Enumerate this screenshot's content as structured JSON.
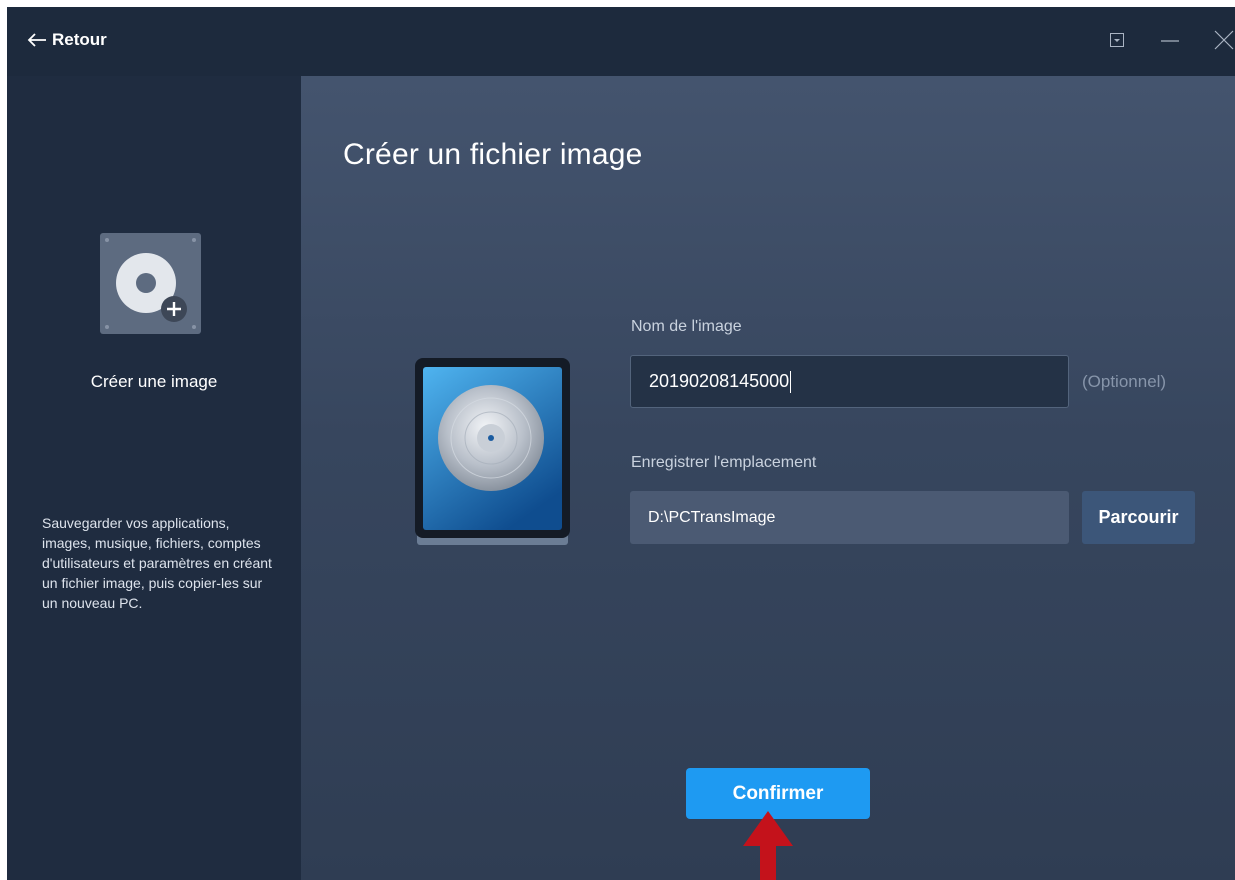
{
  "titlebar": {
    "back_label": "Retour"
  },
  "sidebar": {
    "title": "Créer une image",
    "description": "Sauvegarder vos applications, images, musique, fichiers, comptes d'utilisateurs et paramètres en créant un fichier image, puis copier-les sur un nouveau PC."
  },
  "main": {
    "page_title": "Créer un fichier image",
    "image_name_label": "Nom de l'image",
    "image_name_value": "20190208145000",
    "optional_label": "(Optionnel)",
    "location_label": "Enregistrer l'emplacement",
    "location_value": "D:\\PCTransImage",
    "browse_label": "Parcourir",
    "confirm_label": "Confirmer"
  },
  "colors": {
    "accent": "#1e9af2",
    "titlebar_bg": "#1d2a3d",
    "sidebar_bg": "#1f2c40",
    "annotation_arrow": "#c4121b"
  },
  "icons": [
    "back-arrow-icon",
    "dropdown-box-icon",
    "minimize-icon",
    "close-icon",
    "disk-add-icon",
    "disk-image-icon",
    "annotation-arrow"
  ]
}
